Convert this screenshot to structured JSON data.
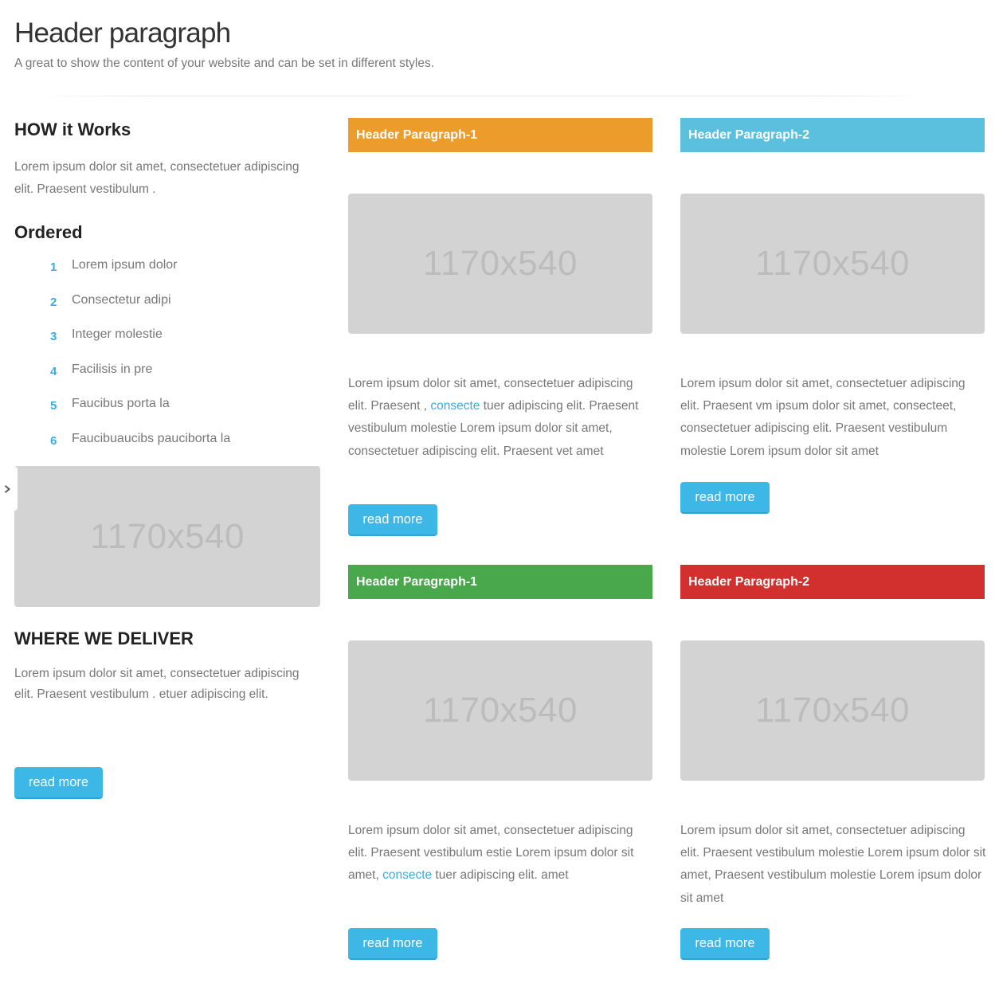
{
  "header": {
    "title": "Header paragraph",
    "subtitle": "A great to show the content of your website and can be set in different styles."
  },
  "left": {
    "how": {
      "title_bold": "HOW it",
      "title_rest": " Works",
      "text": "Lorem ipsum dolor sit amet, consectetuer adipiscing elit. Praesent vestibulum ."
    },
    "ordered": {
      "title": "Ordered",
      "items": [
        {
          "num": "1",
          "label": "Lorem ipsum dolor"
        },
        {
          "num": "2",
          "label": "Consectetur adipi"
        },
        {
          "num": "3",
          "label": "Integer molestie"
        },
        {
          "num": "4",
          "label": "Facilisis in pre"
        },
        {
          "num": "5",
          "label": "Faucibus porta la"
        },
        {
          "num": "6",
          "label": "Faucibuaucibs pauciborta la"
        }
      ]
    },
    "image_placeholder": "1170x540",
    "side_tab_icon": "chevron-right-icon",
    "where": {
      "title_bold": "WHERE",
      "title_rest": " WE DELIVER",
      "text": "Lorem ipsum dolor sit amet, consectetuer adipiscing elit. Praesent vestibulum . etuer adipiscing elit.",
      "button": "read more"
    }
  },
  "colors": {
    "orange": "#ec9c2a",
    "blue": "#5bbfde",
    "green": "#48a84b",
    "red": "#d2302e",
    "button": "#3cb7e6",
    "link": "#3aace0",
    "placeholder": "#d3d3d3"
  },
  "cards": [
    {
      "header": "Header Paragraph-1",
      "color": "#ec9c2a",
      "image_placeholder": "1170x540",
      "text_before": "Lorem ipsum dolor sit amet, consectetuer adipiscing elit. Praesent , ",
      "link": "consecte",
      "text_after": " tuer adipiscing elit. Praesent vestibulum molestie Lorem ipsum dolor sit amet, consectetuer adipiscing elit. Praesent vet amet",
      "button": "read more"
    },
    {
      "header": "Header Paragraph-2",
      "color": "#5bbfde",
      "image_placeholder": "1170x540",
      "text_before": "Lorem ipsum dolor sit amet, consectetuer adipiscing elit. Praesent vm ipsum dolor sit amet, consecteet, consectetuer adipiscing elit. Praesent vestibulum molestie Lorem ipsum dolor sit amet",
      "link": "",
      "text_after": "",
      "button": "read more"
    },
    {
      "header": "Header Paragraph-1",
      "color": "#48a84b",
      "image_placeholder": "1170x540",
      "text_before": "Lorem ipsum dolor sit amet, consectetuer adipiscing elit. Praesent vestibulum estie Lorem ipsum dolor sit amet, ",
      "link": "consecte",
      "text_after": " tuer adipiscing elit. amet",
      "button": "read more"
    },
    {
      "header": "Header Paragraph-2",
      "color": "#d2302e",
      "image_placeholder": "1170x540",
      "text_before": "Lorem ipsum dolor sit amet, consectetuer adipiscing elit. Praesent vestibulum molestie Lorem ipsum dolor sit amet, Praesent vestibulum molestie Lorem ipsum dolor sit amet",
      "link": "",
      "text_after": "",
      "button": "read more"
    }
  ]
}
